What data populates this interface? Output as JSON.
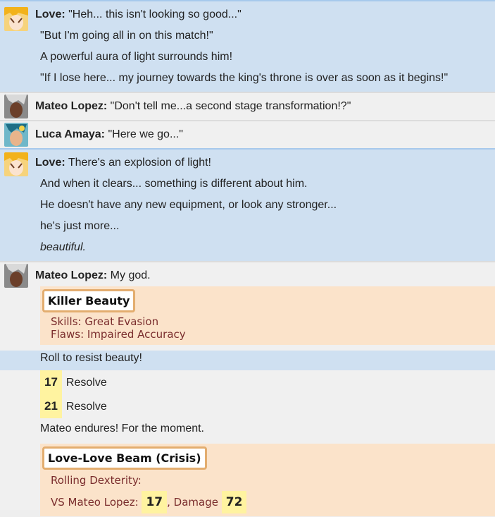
{
  "messages": [
    {
      "speaker": "Love:",
      "lines": [
        "\"Heh... this isn't looking so good...\"",
        "\"But I'm going all in on this match!\"",
        "A powerful aura of light surrounds him!",
        "\"If I lose here... my journey towards the king's throne is over as soon as it begins!\""
      ]
    },
    {
      "speaker": "Mateo Lopez:",
      "lines": [
        "\"Don't tell me...a second stage transformation!?\""
      ]
    },
    {
      "speaker": "Luca Amaya:",
      "lines": [
        "\"Here we go...\""
      ]
    },
    {
      "speaker": "Love:",
      "lines": [
        "There's an explosion of light!",
        "And when it clears... something is different about him.",
        "He doesn't have any new equipment, or look any stronger...",
        "he's just more...",
        "beautiful."
      ]
    },
    {
      "speaker": "Mateo Lopez:",
      "lines": [
        "My god."
      ]
    }
  ],
  "card1": {
    "title": "Killer Beauty",
    "skills": "Skills: Great Evasion",
    "flaws": "Flaws: Impaired Accuracy"
  },
  "roll": {
    "prompt": "Roll to resist beauty!",
    "rows": [
      {
        "value": "17",
        "label": "Resolve"
      },
      {
        "value": "21",
        "label": "Resolve"
      }
    ],
    "result": "Mateo endures! For the moment."
  },
  "card2": {
    "title": "Love-Love Beam (Crisis)",
    "line1": "Rolling Dexterity:",
    "vs": "VS Mateo Lopez:",
    "vs_value": "17",
    "damage_label": ", Damage",
    "damage_value": "72"
  }
}
